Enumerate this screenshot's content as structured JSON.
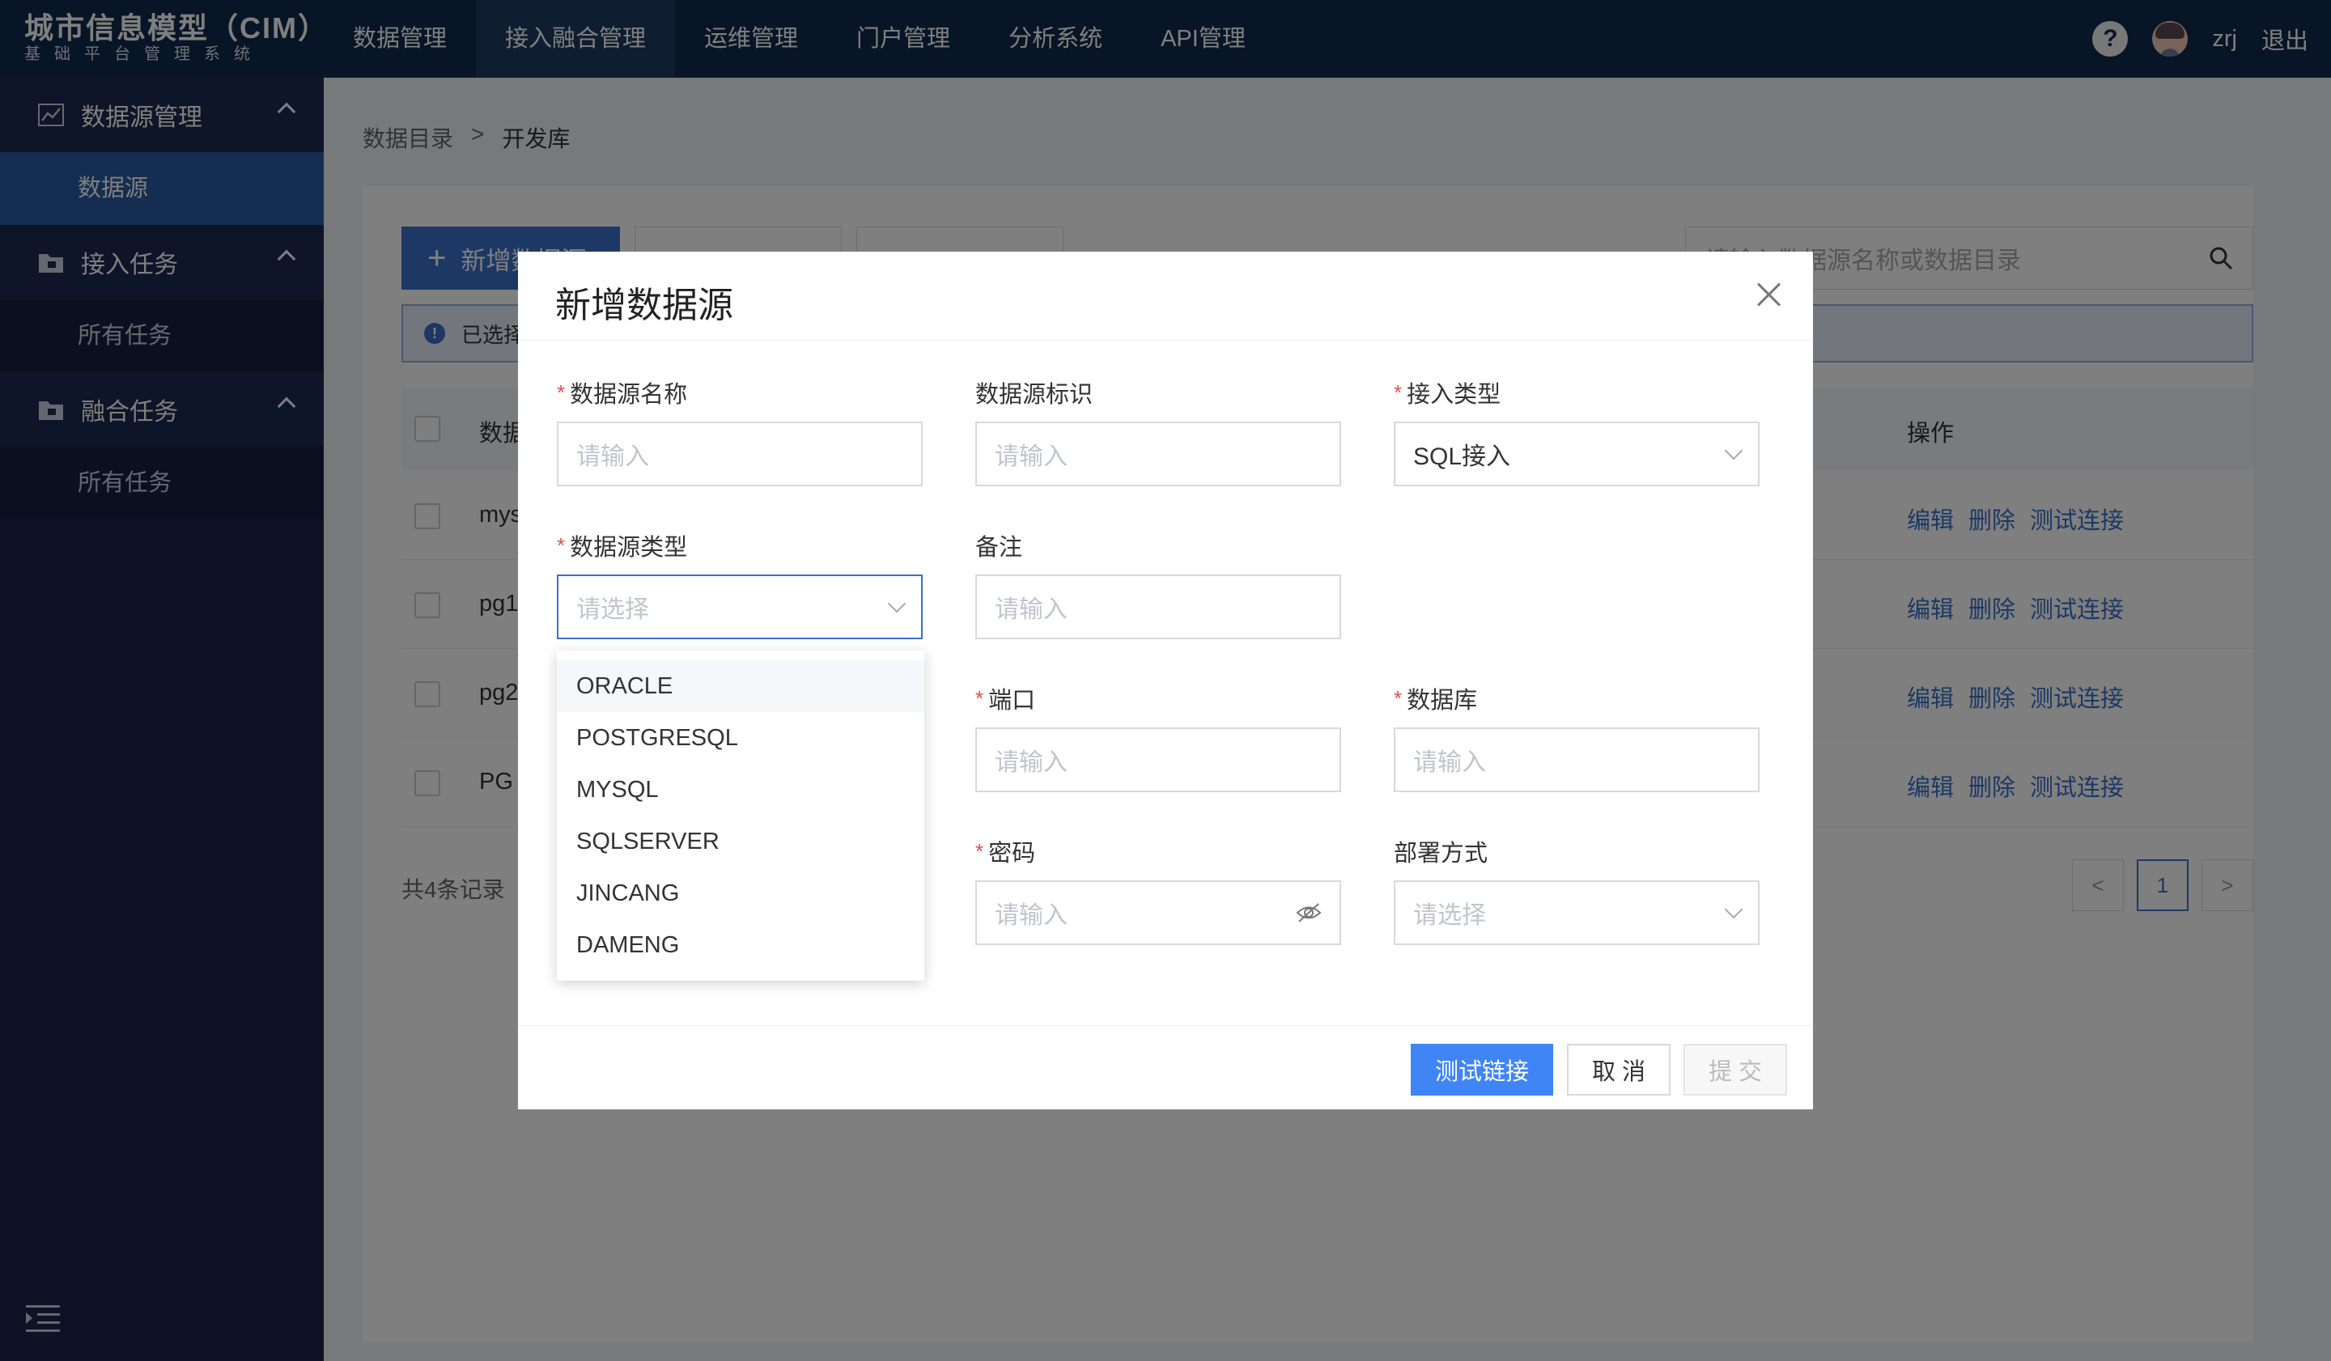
{
  "app": {
    "logo_title": "城市信息模型（CIM）",
    "logo_subtitle": "基础平台管理系统"
  },
  "nav": {
    "items": [
      {
        "label": "数据管理"
      },
      {
        "label": "接入融合管理"
      },
      {
        "label": "运维管理"
      },
      {
        "label": "门户管理"
      },
      {
        "label": "分析系统"
      },
      {
        "label": "API管理"
      }
    ],
    "active": "接入融合管理",
    "help": "?",
    "user": "zrj",
    "logout": "退出"
  },
  "sidebar": {
    "groups": [
      {
        "label": "数据源管理",
        "icon": "chart-icon",
        "items": [
          "数据源"
        ]
      },
      {
        "label": "接入任务",
        "icon": "folder-icon",
        "items": [
          "所有任务"
        ]
      },
      {
        "label": "融合任务",
        "icon": "folder-icon",
        "items": [
          "所有任务"
        ]
      }
    ],
    "active_item": "数据源"
  },
  "breadcrumb": {
    "root": "数据目录",
    "sep": ">",
    "current": "开发库"
  },
  "toolbar": {
    "add_label": "新增数据源",
    "search_placeholder": "请输入数据源名称或数据目录"
  },
  "alert": {
    "text": "已选择"
  },
  "table": {
    "col_name": "数据",
    "col_ops": "操作",
    "rows": [
      {
        "name": "mys"
      },
      {
        "name": "pg1"
      },
      {
        "name": "pg2"
      },
      {
        "name": "PG"
      }
    ],
    "ops": [
      "编辑",
      "删除",
      "测试连接"
    ]
  },
  "pagination": {
    "total": "共4条记录",
    "page": "1",
    "prev": "<",
    "next": ">"
  },
  "modal": {
    "title": "新增数据源",
    "fields": {
      "name": {
        "label": "数据源名称",
        "placeholder": "请输入",
        "required": true
      },
      "ident": {
        "label": "数据源标识",
        "placeholder": "请输入",
        "required": false
      },
      "access_type": {
        "label": "接入类型",
        "value": "SQL接入",
        "required": true
      },
      "ds_type": {
        "label": "数据源类型",
        "placeholder": "请选择",
        "required": true
      },
      "remark": {
        "label": "备注",
        "placeholder": "请输入",
        "required": false
      },
      "port": {
        "label": "端口",
        "placeholder": "请输入",
        "required": true
      },
      "database": {
        "label": "数据库",
        "placeholder": "请输入",
        "required": true
      },
      "password": {
        "label": "密码",
        "placeholder": "请输入",
        "required": true
      },
      "deploy": {
        "label": "部署方式",
        "placeholder": "请选择",
        "required": false
      }
    },
    "required_mark": "*",
    "dropdown_options": [
      "ORACLE",
      "POSTGRESQL",
      "MYSQL",
      "SQLSERVER",
      "JINCANG",
      "DAMENG"
    ],
    "buttons": {
      "test": "测试链接",
      "cancel": "取 消",
      "submit": "提 交"
    }
  },
  "colors": {
    "topbar": "#0f2a4d",
    "sidebar": "#1b2749",
    "primary": "#3f85f5",
    "required": "#e04f4f"
  }
}
